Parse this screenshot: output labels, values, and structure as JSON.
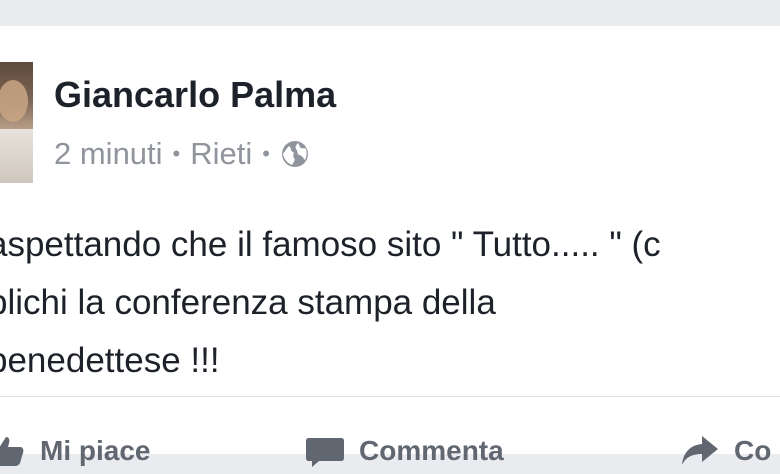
{
  "post": {
    "author": "Giancarlo Palma",
    "time": "2 minuti",
    "location": "Rieti",
    "separator": "•",
    "privacy_icon": "globe-icon",
    "text_lines": [
      "aspettando che il famoso sito \" Tutto..... \" (c",
      "blichi la conferenza stampa della",
      "benedettese !!!"
    ]
  },
  "actions": {
    "like_label": "Mi piace",
    "comment_label": "Commenta",
    "share_label": "Co"
  },
  "colors": {
    "background": "#e9ebee",
    "card": "#ffffff",
    "name": "#1d2129",
    "meta": "#90949c",
    "action": "#616770"
  }
}
